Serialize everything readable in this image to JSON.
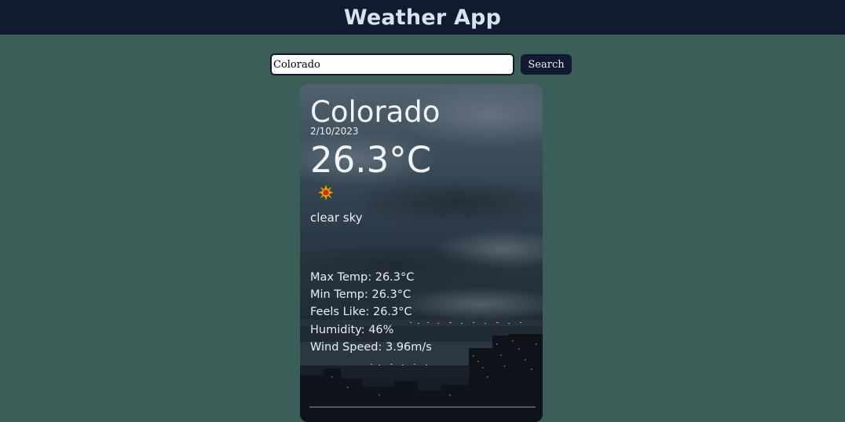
{
  "header": {
    "title": "Weather App"
  },
  "search": {
    "value": "Colorado",
    "button_label": "Search"
  },
  "weather": {
    "city": "Colorado",
    "date": "2/10/2023",
    "temperature": "26.3°C",
    "icon": "sun-icon",
    "description": "clear sky",
    "details": [
      {
        "label": "Max Temp:",
        "value": "26.3°C"
      },
      {
        "label": "Min Temp:",
        "value": "26.3°C"
      },
      {
        "label": "Feels Like:",
        "value": "26.3°C"
      },
      {
        "label": "Humidity:",
        "value": "46%"
      },
      {
        "label": "Wind Speed:",
        "value": "3.96m/s"
      }
    ]
  },
  "colors": {
    "page_background": "#3b5f58",
    "header_background": "#111a30",
    "button_background": "#111a30",
    "title_text": "#d6e4f0",
    "sun_fill": "#e8a100",
    "sun_core": "#d62d0f"
  }
}
